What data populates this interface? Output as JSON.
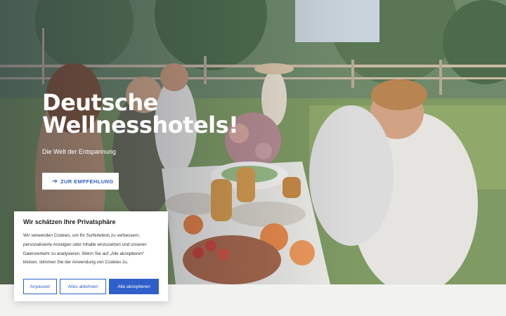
{
  "hero": {
    "title": "Deutsche\nWellnesshotels!",
    "subtitle": "Die Welt der Entspannung",
    "cta_label": "ZUR EMPFEHLUNG",
    "cta_icon": "arrow-right-icon",
    "image_description": "friends toasting at outdoor picnic table"
  },
  "cookie_banner": {
    "title": "Wir schätzen Ihre Privatsphäre",
    "text": "Wir verwenden Cookies, um Ihr Surferlebnis zu verbessern, personalisierte Anzeigen oder Inhalte einzusetzen und unseren Datenverkehr zu analysieren. Wenn Sie auf „Alle akzeptieren“ klicken, stimmen Sie der Anwendung von Cookies zu.",
    "buttons": {
      "customize": "Anpassen",
      "reject_all": "Alles ablehnen",
      "accept_all": "Alle akzeptieren"
    }
  },
  "colors": {
    "accent": "#2f5fc9",
    "background": "#f2f2f0"
  }
}
